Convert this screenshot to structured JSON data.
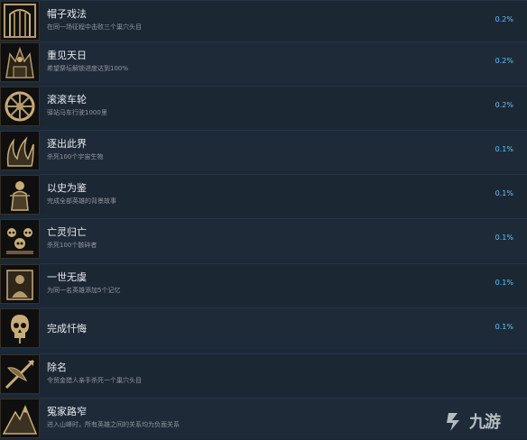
{
  "achievements": [
    {
      "title": "帽子戏法",
      "desc": "在同一场征程中击败三个巢穴头目",
      "pct": "0.2%",
      "icon": "cage-gate-icon"
    },
    {
      "title": "重见天日",
      "desc": "希望祭坛解锁进度达到100%",
      "pct": "0.2%",
      "icon": "altar-icon"
    },
    {
      "title": "滚滚车轮",
      "desc": "驿站马车行驶1000里",
      "pct": "0.2%",
      "icon": "wagon-wheel-icon"
    },
    {
      "title": "逐出此界",
      "desc": "杀死100个宇宙生物",
      "pct": "0.1%",
      "icon": "tentacle-icon"
    },
    {
      "title": "以史为鉴",
      "desc": "完成全部英雄的背景故事",
      "pct": "0.1%",
      "icon": "hero-figure-icon"
    },
    {
      "title": "亡灵归亡",
      "desc": "杀死100个骸碎者",
      "pct": "0.1%",
      "icon": "undead-skulls-icon"
    },
    {
      "title": "一世无虞",
      "desc": "为同一名英雄添加5个记忆",
      "pct": "0.1%",
      "icon": "memory-portrait-icon"
    },
    {
      "title": "完成忏悔",
      "desc": "",
      "pct": "0.1%",
      "icon": "skull-icon"
    },
    {
      "title": "除名",
      "desc": "令贸金猎人亲手杀死一个巢穴头目",
      "pct": "",
      "icon": "crossbow-icon"
    },
    {
      "title": "冤家路窄",
      "desc": "进入山峰时，所有英雄之间的关系均为负面关系",
      "pct": "",
      "icon": "mountain-peak-icon"
    }
  ],
  "watermark": {
    "text": "九游"
  }
}
